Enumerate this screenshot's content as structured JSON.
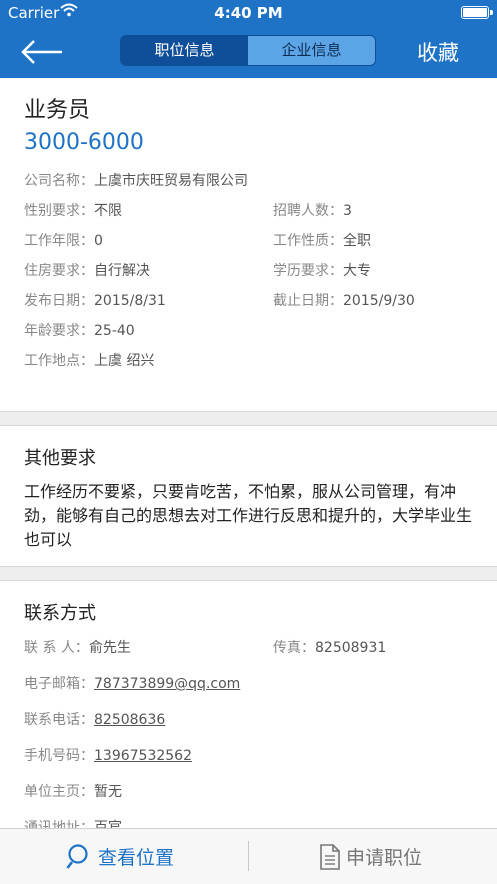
{
  "status_bar": {
    "carrier": "Carrier",
    "time": "4:40 PM"
  },
  "nav": {
    "tabs": [
      {
        "label": "职位信息",
        "active": true
      },
      {
        "label": "企业信息",
        "active": false
      }
    ],
    "favorite_label": "收藏"
  },
  "job": {
    "title": "业务员",
    "salary": "3000-6000",
    "company": {
      "label": "公司名称：",
      "value": "上虞市庆旺贸易有限公司"
    },
    "gender": {
      "label": "性别要求：",
      "value": "不限"
    },
    "headcount": {
      "label": "招聘人数：",
      "value": "3"
    },
    "experience": {
      "label": "工作年限：",
      "value": "0"
    },
    "nature": {
      "label": "工作性质：",
      "value": "全职"
    },
    "housing": {
      "label": "住房要求：",
      "value": "自行解决"
    },
    "education": {
      "label": "学历要求：",
      "value": "大专"
    },
    "publish_date": {
      "label": "发布日期：",
      "value": "2015/8/31"
    },
    "deadline": {
      "label": "截止日期：",
      "value": "2015/9/30"
    },
    "age": {
      "label": "年龄要求：",
      "value": "25-40"
    },
    "location": {
      "label": "工作地点：",
      "value": "上虞 绍兴"
    }
  },
  "other": {
    "title": "其他要求",
    "text": "工作经历不要紧，只要肯吃苦，不怕累，服从公司管理，有冲劲，能够有自己的思想去对工作进行反思和提升的，大学毕业生也可以"
  },
  "contact": {
    "title": "联系方式",
    "person": {
      "label": "联 系 人：",
      "value": "俞先生"
    },
    "fax": {
      "label": "传真：",
      "value": "82508931"
    },
    "email": {
      "label": "电子邮箱：",
      "value": "787373899@qq.com"
    },
    "phone": {
      "label": "联系电话：",
      "value": "82508636"
    },
    "mobile": {
      "label": "手机号码：",
      "value": "13967532562"
    },
    "homepage": {
      "label": "单位主页：",
      "value": "暂无"
    },
    "address": {
      "label": "通讯地址：",
      "value": "百官"
    }
  },
  "footer": {
    "view_location": "查看位置",
    "apply": "申请职位"
  },
  "colors": {
    "primary": "#1e73c6",
    "nav_selected": "#0f4f99",
    "nav_unselected": "#5ba4e6"
  }
}
